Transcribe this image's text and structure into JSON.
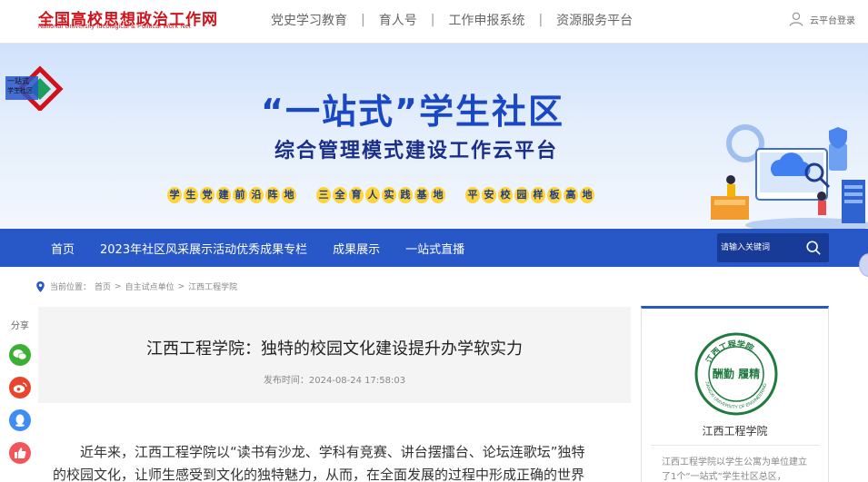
{
  "header": {
    "logo_cn": "全国高校思想政治工作网",
    "logo_en": "National University Ideological & Political Work Net",
    "nav": [
      "党史学习教育",
      "育人号",
      "工作申报系统",
      "资源服务平台"
    ],
    "separator": "|",
    "login_label": "云平台登录"
  },
  "banner": {
    "logo_text_1": "一站式",
    "logo_text_2": "学生社区",
    "title": "“一站式”学生社区",
    "subtitle": "综合管理模式建设工作云平台",
    "slogans": [
      "学生党建前沿阵地",
      "三全育人实践基地",
      "平安校园样板高地"
    ]
  },
  "mainnav": {
    "items": [
      "首页",
      "2023年社区风采展示活动优秀成果专栏",
      "成果展示",
      "一站式直播"
    ],
    "search_placeholder": "请输入关键词"
  },
  "breadcrumb": {
    "label": "当前位置：",
    "items": [
      "首页",
      "自主试点单位",
      "江西工程学院"
    ],
    "sep": ">"
  },
  "share": {
    "label": "分享",
    "icons": [
      "wechat-icon",
      "weibo-icon",
      "qq-icon",
      "like-icon"
    ]
  },
  "article": {
    "title": "江西工程学院：独特的校园文化建设提升办学软实力",
    "date_label": "发布时间：",
    "date": "2024-08-24 17:58:03",
    "body_line_1": "近年来，江西工程学院以“读书有沙龙、学科有竞赛、讲台摆擂台、论坛连歌坛”独特",
    "body_line_2": "的校园文化，让师生感受到文化的独特魅力，从而，在全面发展的过程中形成正确的世界"
  },
  "school_panel": {
    "seal_top": "江西工程学院",
    "seal_en": "JIANGXI UNIVERSITY OF ENGINEERING",
    "seal_center": "酬勤 履精",
    "name": "江西工程学院",
    "desc": "江西工程学院以学生公寓为单位建立了1个“一站式”学生社区总区，"
  },
  "colors": {
    "brand_red": "#d0121b",
    "nav_blue": "#2857c8",
    "title_blue": "#1a48c4",
    "slogan_yellow": "#ffd43b",
    "seal_green": "#1e7a3e"
  }
}
